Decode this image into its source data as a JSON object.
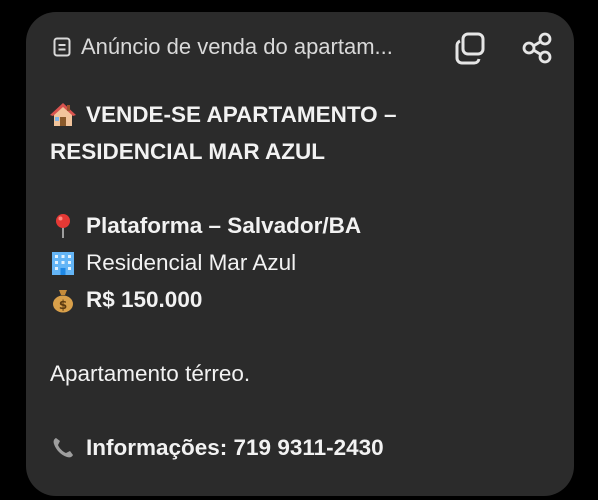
{
  "header": {
    "title": "Anúncio de venda do apartam...",
    "doc_icon": "document-icon",
    "copy_icon": "copy-icon",
    "share_icon": "share-icon"
  },
  "message": {
    "title_line1": "VENDE-SE APARTAMENTO –",
    "title_line2": "RESIDENCIAL MAR AZUL",
    "location": "Plataforma – Salvador/BA",
    "building": "Residencial Mar Azul",
    "price": "R$ 150.000",
    "description": "Apartamento térreo.",
    "contact": "Informações: 719 9311-2430"
  },
  "icons": {
    "title": "house-icon",
    "location": "pin-icon",
    "building": "building-icon",
    "price": "money-bag-icon",
    "contact": "phone-icon"
  },
  "colors": {
    "card_background": "#2b2b2b",
    "page_background": "#000000",
    "text": "#f2f2f2",
    "header_text": "#d9d9d9"
  }
}
